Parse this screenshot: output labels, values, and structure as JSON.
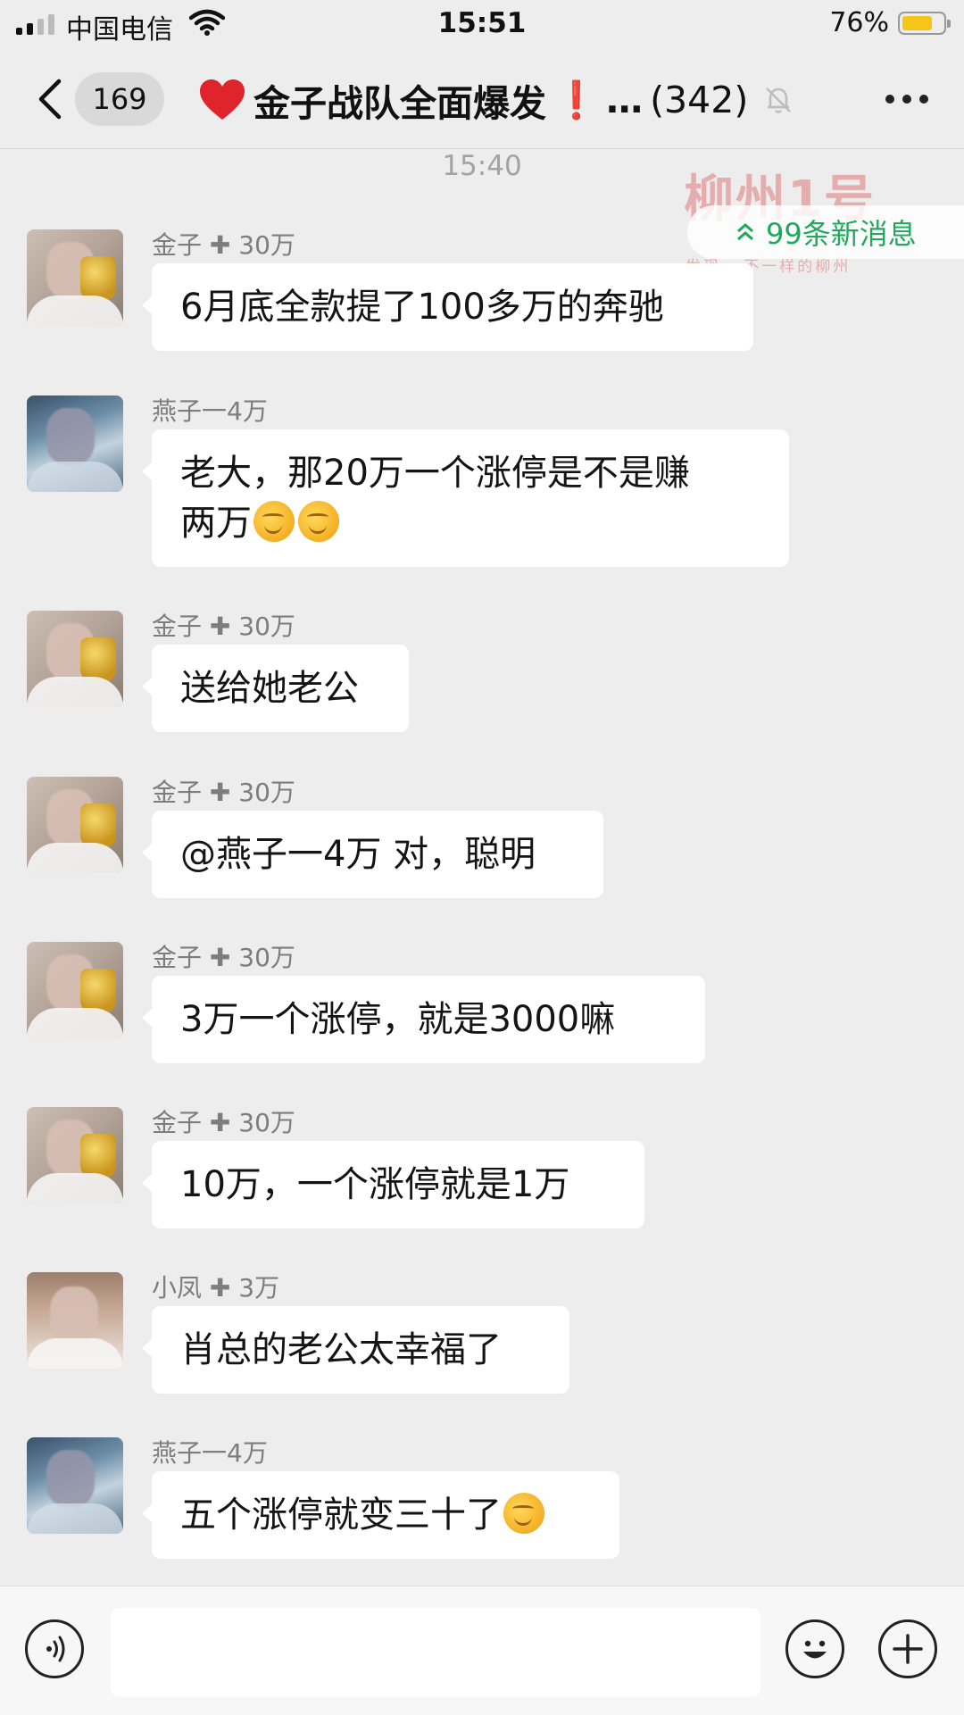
{
  "status_bar": {
    "carrier": "中国电信",
    "time": "15:51",
    "battery_percent": "76%",
    "battery_level": 0.76,
    "battery_color": "#f5c518",
    "signal_icon": "signal-bars-icon",
    "wifi_icon": "wifi-icon"
  },
  "header": {
    "back_icon": "chevron-left-icon",
    "unread_count": "169",
    "title_emoji_icon": "red-heart-icon",
    "title": "金子战队全面爆发",
    "title_mark": "❗",
    "title_ellipsis": "…",
    "member_count": "(342)",
    "mute_icon": "bell-muted-icon",
    "more_icon": "more-dots-icon"
  },
  "timestamp": "15:40",
  "watermark": {
    "text": "柳州1号",
    "subtext": "发现 · 不一样的柳州"
  },
  "new_messages": {
    "icon": "double-chevron-up-icon",
    "label": "99条新消息",
    "color": "#1fa95b"
  },
  "messages": [
    {
      "sender": "金子 ✚ 30万",
      "lines": [
        "6月底全款提了100多万的奔驰"
      ],
      "emoji": []
    },
    {
      "sender": "燕子一4万",
      "lines": [
        "老大，那20万一个涨停是不是赚",
        "两万"
      ],
      "emoji": [
        "thinking-face-icon",
        "thinking-face-icon"
      ]
    },
    {
      "sender": "金子 ✚ 30万",
      "lines": [
        "送给她老公"
      ],
      "emoji": []
    },
    {
      "sender": "金子 ✚ 30万",
      "lines": [
        "@燕子一4万 对，聪明"
      ],
      "emoji": []
    },
    {
      "sender": "金子 ✚ 30万",
      "lines": [
        "3万一个涨停，就是3000嘛"
      ],
      "emoji": []
    },
    {
      "sender": "金子 ✚ 30万",
      "lines": [
        "10万，一个涨停就是1万"
      ],
      "emoji": []
    },
    {
      "sender": "小凤 ✚ 3万",
      "lines": [
        "肖总的老公太幸福了"
      ],
      "emoji": []
    },
    {
      "sender": "燕子一4万",
      "lines": [
        "五个涨停就变三十了"
      ],
      "emoji": [
        "thinking-face-icon"
      ]
    }
  ],
  "input_bar": {
    "voice_icon": "voice-input-icon",
    "text_value": "",
    "emoji_icon": "emoji-smile-icon",
    "plus_icon": "plus-circle-icon"
  }
}
